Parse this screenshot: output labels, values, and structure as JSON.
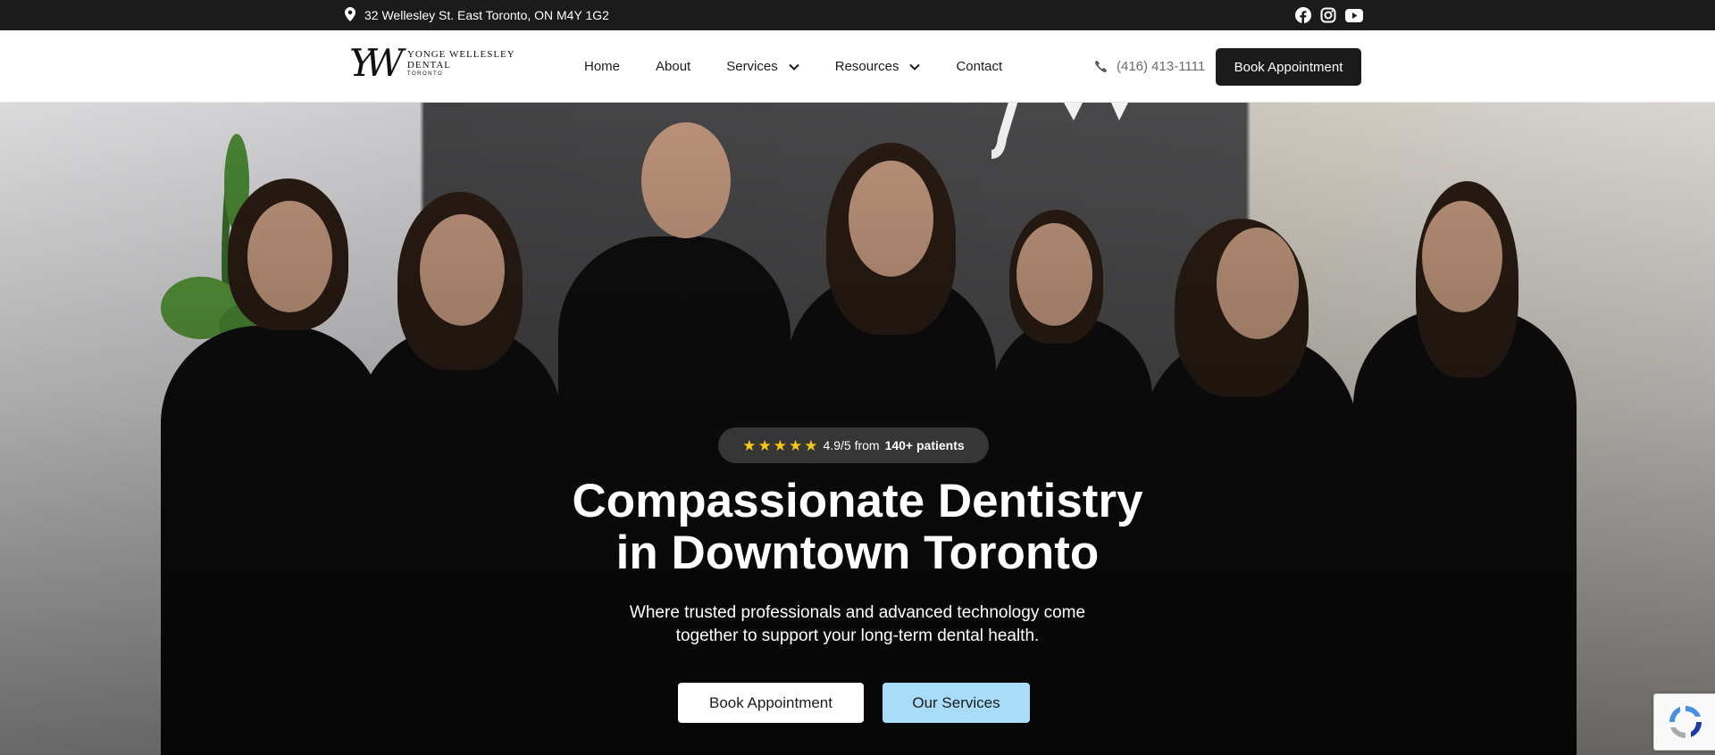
{
  "topbar": {
    "address": "32 Wellesley St. East Toronto, ON M4Y 1G2",
    "social": [
      "facebook-icon",
      "instagram-icon",
      "youtube-icon"
    ]
  },
  "header": {
    "logo": {
      "mark": "YW",
      "line1": "YONGE WELLESLEY",
      "line2": "DENTAL",
      "line3": "TORONTO"
    },
    "nav": [
      {
        "label": "Home"
      },
      {
        "label": "About"
      },
      {
        "label": "Services"
      },
      {
        "label": "Resources"
      },
      {
        "label": "Contact"
      }
    ],
    "phone": "(416) 413-1111",
    "book_label": "Book Appointment"
  },
  "hero": {
    "rating_score": "4.9/5 from",
    "rating_patients": "140+ patients",
    "headline_line1": "Compassionate Dentistry",
    "headline_line2": "in Downtown Toronto",
    "subtext_line1": "Where trusted professionals and advanced technology come",
    "subtext_line2": "together to support your long-term dental health.",
    "cta_primary": "Book Appointment",
    "cta_secondary": "Our Services"
  },
  "colors": {
    "topbar_bg": "#1b1b1b",
    "accent_button": "#a9dcf6",
    "star": "#f5c518"
  }
}
